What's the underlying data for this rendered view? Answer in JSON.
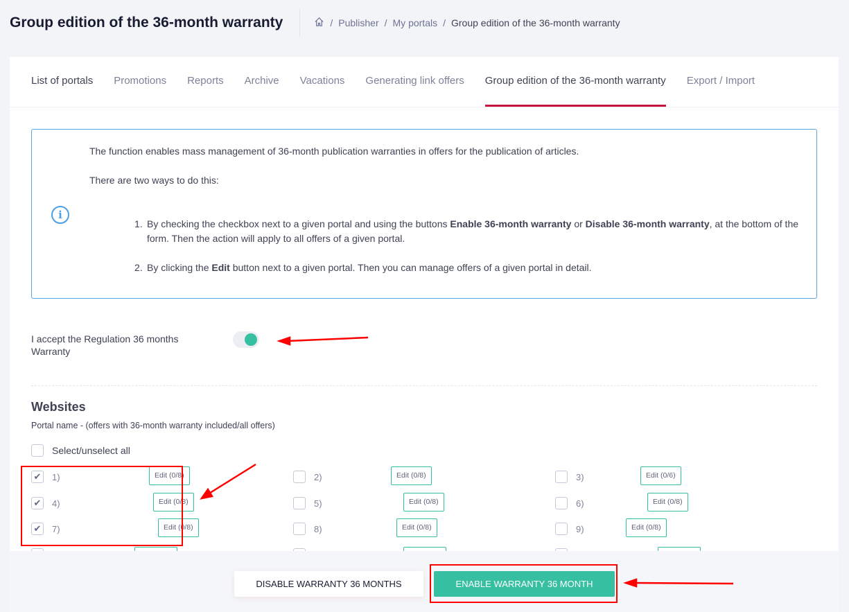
{
  "header": {
    "title": "Group edition of the 36-month warranty",
    "breadcrumb": [
      "Publisher",
      "My portals",
      "Group edition of the 36-month warranty"
    ]
  },
  "tabs": [
    "List of portals",
    "Promotions",
    "Reports",
    "Archive",
    "Vacations",
    "Generating link offers",
    "Group edition of the 36-month warranty",
    "Export / Import"
  ],
  "active_tab": "Group edition of the 36-month warranty",
  "info": {
    "p1": "The function enables mass management of 36-month publication warranties in offers for the publication of articles.",
    "p2": "There are two ways to do this:",
    "item1": {
      "n": "1.",
      "a": "By checking the checkbox next to a given portal and using the buttons ",
      "b1": "Enable 36-month warranty",
      "c": " or ",
      "b2": "Disable 36-month warranty",
      "d": ", at the bottom of the form. Then the action will apply to all offers of a given portal."
    },
    "item2": {
      "n": "2.",
      "a": "By clicking the ",
      "b": "Edit",
      "c": " button next to a given portal. Then you can manage offers of a given portal in detail."
    }
  },
  "accept": {
    "label": "I accept the Regulation 36 months Warranty",
    "on": true
  },
  "websites": {
    "title": "Websites",
    "subtitle": "Portal name - (offers with 36-month warranty included/all offers)",
    "select_all": "Select/unselect all",
    "items": [
      {
        "label": "1)",
        "edit": "Edit (0/8)",
        "checked": true
      },
      {
        "label": "2)",
        "edit": "Edit (0/8)",
        "checked": false
      },
      {
        "label": "3)",
        "edit": "Edit (0/6)",
        "checked": false
      },
      {
        "label": "4)",
        "edit": "Edit (0/8)",
        "checked": true
      },
      {
        "label": "5)",
        "edit": "Edit (0/8)",
        "checked": false
      },
      {
        "label": "6)",
        "edit": "Edit (0/8)",
        "checked": false
      },
      {
        "label": "7)",
        "edit": "Edit (0/8)",
        "checked": true
      },
      {
        "label": "8)",
        "edit": "Edit (0/8)",
        "checked": false
      },
      {
        "label": "9)",
        "edit": "Edit (0/8)",
        "checked": false
      }
    ]
  },
  "buttons": {
    "disable": "Disable warranty 36 months",
    "enable": "Enable warranty 36 month"
  },
  "colors": {
    "accent": "#36bfa0",
    "tab_underline": "#c8163e",
    "info_border": "#5aa7e3",
    "annotation": "#ff0000"
  }
}
